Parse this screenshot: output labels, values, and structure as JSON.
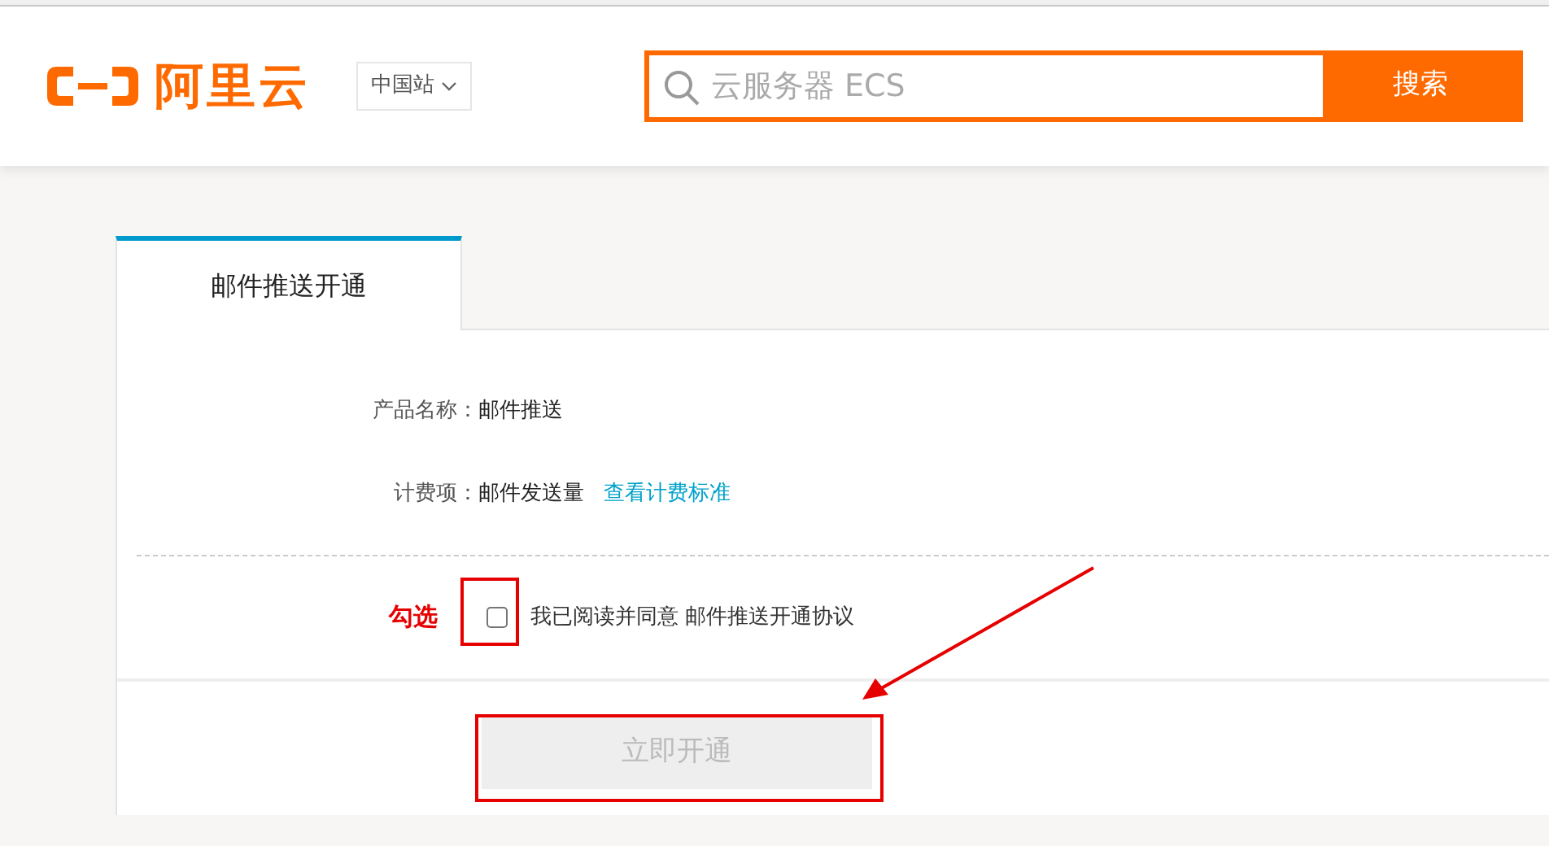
{
  "header": {
    "logo_text": "阿里云",
    "region": "中国站",
    "search": {
      "placeholder": "云服务器 ECS",
      "button": "搜索"
    }
  },
  "tabs": [
    {
      "label": "邮件推送开通",
      "selected": true
    }
  ],
  "fields": [
    {
      "label": "产品名称：",
      "value": "邮件推送"
    },
    {
      "label": "计费项：",
      "value": "邮件发送量",
      "link": "查看计费标准"
    }
  ],
  "agreement": {
    "checked": false,
    "text": "我已阅读并同意 邮件推送开通协议"
  },
  "submit": {
    "label": "立即开通",
    "disabled": true
  },
  "annotation": {
    "label": "勾选"
  }
}
